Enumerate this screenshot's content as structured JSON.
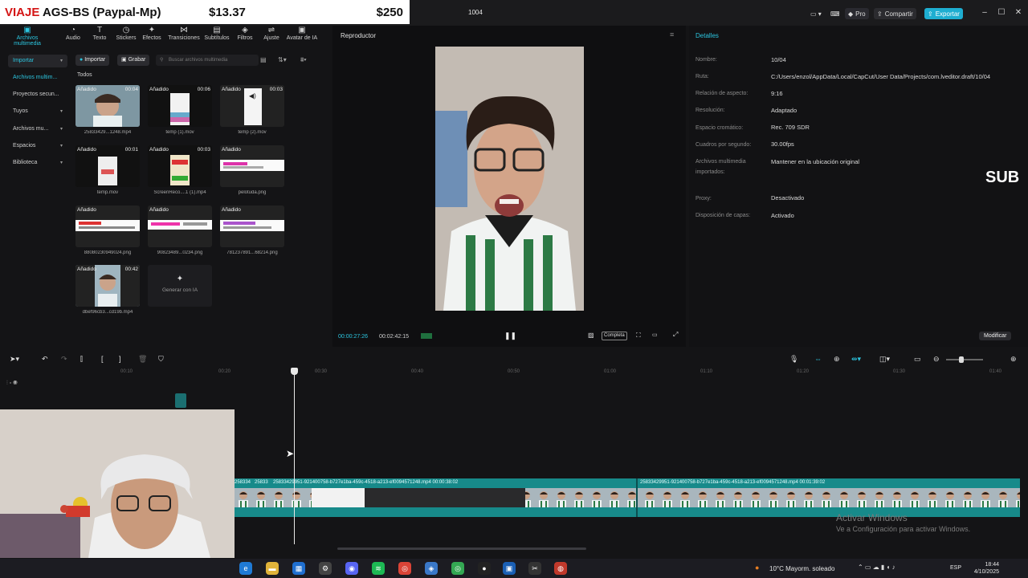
{
  "donation": {
    "title_prefix": "VIAJE",
    "title_rest": " AGS-BS (Paypal-Mp)",
    "amount1": "$13.37",
    "amount2": "$250"
  },
  "window": {
    "title": "1004",
    "pro": "Pro",
    "share": "Compartir",
    "export": "Exportar"
  },
  "toolbar": {
    "tools": [
      "Archivos multimedia",
      "Audio",
      "Texto",
      "Stickers",
      "Efectos",
      "Transiciones",
      "Subtítulos",
      "Filtros",
      "Ajuste",
      "Avatar de IA"
    ]
  },
  "leftnav": {
    "items": [
      "Importar",
      "Archivos multim...",
      "Proyectos secun...",
      "Tuyos",
      "Archivos mu...",
      "Espacios",
      "Biblioteca"
    ]
  },
  "media": {
    "import_btn": "Importar",
    "record_btn": "Grabar",
    "search_placeholder": "Buscar archivos multimedia",
    "all_label": "Todos",
    "added_tag": "Añadido",
    "generate_label": "Generar con IA",
    "items": [
      {
        "name": "25833429...1248.mp4",
        "dur": "00:04"
      },
      {
        "name": "temp (1).mov",
        "dur": "00:06"
      },
      {
        "name": "temp (2).mov",
        "dur": "00:03"
      },
      {
        "name": "temp.mov",
        "dur": "00:01"
      },
      {
        "name": "ScreenReco....1 (1).mp4",
        "dur": "00:03"
      },
      {
        "name": "pelotuda.png",
        "dur": ""
      },
      {
        "name": "88080230949024.png",
        "dur": ""
      },
      {
        "name": "90823489...0234.png",
        "dur": ""
      },
      {
        "name": "781237891...68214.png",
        "dur": ""
      },
      {
        "name": "dbef96cb3...cd19b.mp4",
        "dur": "00:42"
      }
    ]
  },
  "player": {
    "title": "Reproductor",
    "current": "00:00:27:26",
    "total": "00:02:42:15",
    "ratio_btn": "Completa"
  },
  "details": {
    "title": "Detalles",
    "rows": [
      {
        "label": "Nombre:",
        "value": "10/04"
      },
      {
        "label": "Ruta:",
        "value": "C:/Users/enzol/AppData/Local/CapCut/User Data/Projects/com.lveditor.draft/10/04"
      },
      {
        "label": "Relación de aspecto:",
        "value": "9:16"
      },
      {
        "label": "Resolución:",
        "value": "Adaptado"
      },
      {
        "label": "Espacio cromático:",
        "value": "Rec. 709 SDR"
      },
      {
        "label": "Cuadros por segundo:",
        "value": "30.00fps"
      },
      {
        "label": "Archivos multimedia importados:",
        "value": "Mantener en la ubicación original"
      },
      {
        "label": "Proxy:",
        "value": "Desactivado"
      },
      {
        "label": "Disposición de capas:",
        "value": "Activado"
      }
    ],
    "modify": "Modificar",
    "overlay_text": "SUB"
  },
  "timeline": {
    "ticks": [
      "00:10",
      "00:20",
      "00:30",
      "00:40",
      "00:50",
      "01:00",
      "01:10",
      "01:20",
      "01:30",
      "01:40"
    ],
    "clip1_label": "25833429951-921400758-b727e1ba-459c-4518-a213-ef0094571248.mp4  00:00:38:02",
    "clip2_label": "25833429951-921400758-b727e1ba-459c-4518-a213-ef0094571248.mp4  00:01:39:02",
    "clip0_label": "25833",
    "clip00_label": "258334"
  },
  "watermark": {
    "line1": "Activar Windows",
    "line2": "Ve a Configuración para activar Windows."
  },
  "taskbar": {
    "weather": "10°C  Mayorm. soleado",
    "lang": "ESP",
    "time": "18:44",
    "date": "4/10/2025"
  },
  "colors": {
    "accent": "#2cc6e0",
    "track": "#178a8a",
    "export": "#1eaed1"
  }
}
